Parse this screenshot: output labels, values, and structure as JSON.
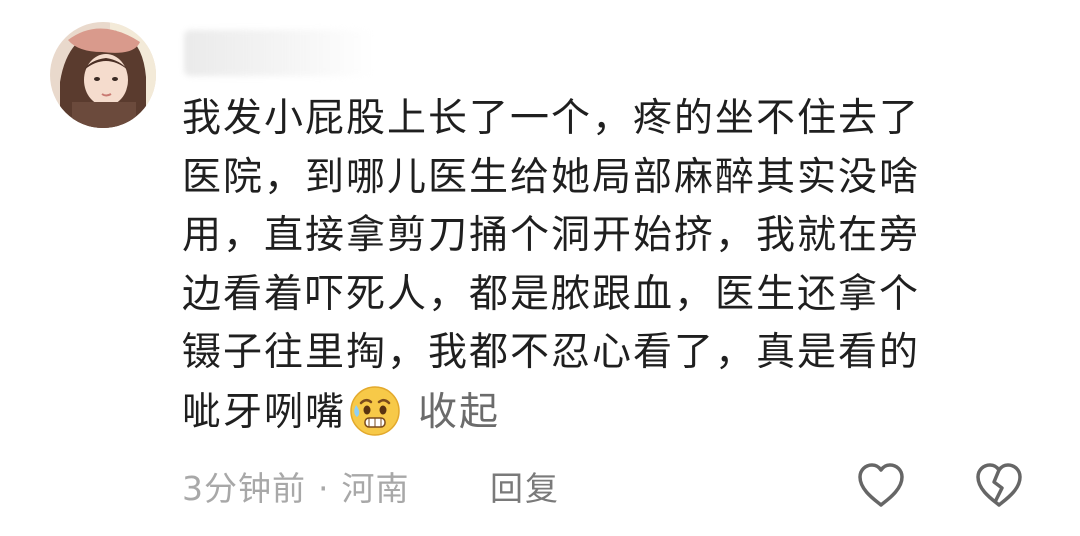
{
  "comment": {
    "content_lines": [
      "我发小屁股上长了一个，疼的坐不住去了",
      "医院，到哪儿医生给她局部麻醉其实没啥",
      "用，直接拿剪刀捅个洞开始挤，我就在旁",
      "边看着吓死人，都是脓跟血，医生还拿个",
      "镊子往里掏，我都不忍心看了，真是看的"
    ],
    "last_line": "呲牙咧嘴",
    "emoji_icon": "sweating-face-emoji",
    "collapse_label": "收起",
    "time": "3分钟前",
    "separator": "·",
    "location": "河南",
    "reply_label": "回复",
    "like_icon": "heart-outline-icon",
    "dislike_icon": "broken-heart-icon"
  },
  "colors": {
    "text": "#1f1f1f",
    "meta": "#a8a8a8",
    "collapse": "#6b6b6b",
    "icon": "#666666"
  }
}
